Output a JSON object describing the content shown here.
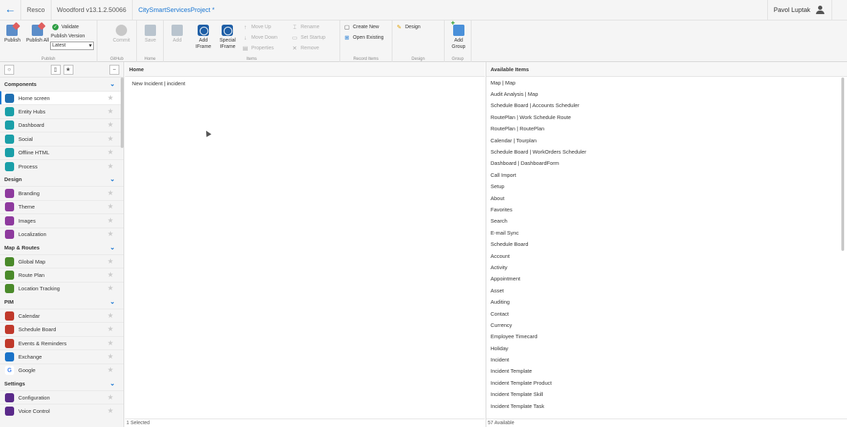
{
  "titlebar": {
    "app": "Resco",
    "version": "Woodford v13.1.2.50066",
    "project": "CitySmartServicesProject *",
    "user": "Pavol Luptak"
  },
  "ribbon": {
    "publish": {
      "label": "Publish",
      "publish_btn": "Publish",
      "publish_all_btn": "Publish All",
      "validate": "Validate",
      "version_label": "Publish Version",
      "version_value": "Latest"
    },
    "github": {
      "label": "GitHub",
      "commit": "Commit"
    },
    "home": {
      "label": "Home",
      "save": "Save"
    },
    "items": {
      "label": "Items",
      "add": "Add",
      "add_iframe": [
        "Add",
        "IFrame"
      ],
      "special_iframe": [
        "Special",
        "IFrame"
      ],
      "move_up": "Move Up",
      "move_down": "Move Down",
      "properties": "Properties",
      "rename": "Rename",
      "set_startup": "Set Startup",
      "remove": "Remove"
    },
    "record_items": {
      "label": "Record Items",
      "create_new": "Create New",
      "open_existing": "Open Existing"
    },
    "design": {
      "label": "Design",
      "design": "Design"
    },
    "group": {
      "label": "Group",
      "add_group": [
        "Add",
        "Group"
      ]
    }
  },
  "left": {
    "sections": [
      {
        "title": "Components",
        "items": [
          {
            "label": "Home screen",
            "color": "#1f6fb2",
            "icon": "home-icon",
            "selected": true
          },
          {
            "label": "Entity Hubs",
            "color": "#1a9fa8",
            "icon": "hub-icon"
          },
          {
            "label": "Dashboard",
            "color": "#1a9fa8",
            "icon": "dashboard-icon"
          },
          {
            "label": "Social",
            "color": "#1a9fa8",
            "icon": "chat-icon"
          },
          {
            "label": "Offline HTML",
            "color": "#1a9fa8",
            "icon": "html-icon"
          },
          {
            "label": "Process",
            "color": "#1a9fa8",
            "icon": "process-icon"
          }
        ]
      },
      {
        "title": "Design",
        "items": [
          {
            "label": "Branding",
            "color": "#8e3a9e",
            "icon": "branding-icon"
          },
          {
            "label": "Theme",
            "color": "#8e3a9e",
            "icon": "theme-icon"
          },
          {
            "label": "Images",
            "color": "#8e3a9e",
            "icon": "images-icon"
          },
          {
            "label": "Localization",
            "color": "#8e3a9e",
            "icon": "localization-icon"
          }
        ]
      },
      {
        "title": "Map & Routes",
        "items": [
          {
            "label": "Global Map",
            "color": "#4a8a2a",
            "icon": "map-icon"
          },
          {
            "label": "Route Plan",
            "color": "#4a8a2a",
            "icon": "route-icon"
          },
          {
            "label": "Location Tracking",
            "color": "#4a8a2a",
            "icon": "location-icon"
          }
        ]
      },
      {
        "title": "PIM",
        "items": [
          {
            "label": "Calendar",
            "color": "#c0392b",
            "icon": "calendar-icon"
          },
          {
            "label": "Schedule Board",
            "color": "#c0392b",
            "icon": "schedule-icon"
          },
          {
            "label": "Events & Reminders",
            "color": "#c0392b",
            "icon": "bell-icon"
          },
          {
            "label": "Exchange",
            "color": "#1a73c8",
            "icon": "exchange-icon"
          },
          {
            "label": "Google",
            "color": "#ffffff",
            "icon": "google-icon"
          }
        ]
      },
      {
        "title": "Settings",
        "items": [
          {
            "label": "Configuration",
            "color": "#5a2a8a",
            "icon": "configuration-icon"
          },
          {
            "label": "Voice Control",
            "color": "#5a2a8a",
            "icon": "microphone-icon"
          }
        ]
      }
    ]
  },
  "home": {
    "header": "Home",
    "items": [
      "New Incident | incident"
    ],
    "status": "1 Selected"
  },
  "available": {
    "header": "Available Items",
    "items": [
      "Map | Map",
      "Audit Analysis | Map",
      "Schedule Board | Accounts Scheduler",
      "RoutePlan | Work Schedule Route",
      "RoutePlan | RoutePlan",
      "Calendar | Tourplan",
      "Schedule Board | WorkOrders Scheduler",
      "Dashboard | DashboardForm",
      "Call Import",
      "Setup",
      "About",
      "Favorites",
      "Search",
      "E-mail Sync",
      "Schedule Board",
      "Account",
      "Activity",
      "Appointment",
      "Asset",
      "Auditing",
      "Contact",
      "Currency",
      "Employee Timecard",
      "Holiday",
      "Incident",
      "Incident Template",
      "Incident Template Product",
      "Incident Template Skill",
      "Incident Template Task"
    ],
    "status": "57 Available"
  }
}
